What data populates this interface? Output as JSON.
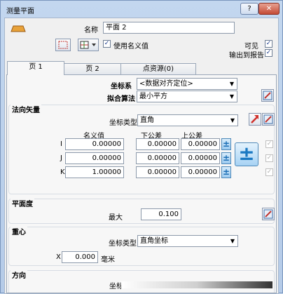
{
  "window": {
    "title": "测量平面",
    "help_label": "?",
    "close_label": "✕"
  },
  "header": {
    "name_label": "名称",
    "name_value": "平面 2",
    "use_nominal_label": "使用名义值",
    "visible_label": "可见",
    "output_report_label": "输出到报告"
  },
  "tabs": [
    {
      "label": "页 1",
      "active": true
    },
    {
      "label": "页 2",
      "active": false
    },
    {
      "label": "点资源(0)",
      "active": false
    }
  ],
  "coordinate_system": {
    "label": "坐标系",
    "value": "<数据对齐定位>"
  },
  "fit_algorithm": {
    "label": "拟合算法",
    "value": "最小平方"
  },
  "normal_vector": {
    "title": "法向矢量",
    "coord_type_label": "坐标类型",
    "coord_type_value": "直角",
    "col_nominal": "名义值",
    "col_lower": "下公差",
    "col_upper": "上公差",
    "rows": [
      {
        "axis": "I",
        "nominal": "0.00000",
        "lower": "0.00000",
        "upper": "0.00000"
      },
      {
        "axis": "J",
        "nominal": "0.00000",
        "lower": "0.00000",
        "upper": "0.00000"
      },
      {
        "axis": "K",
        "nominal": "1.00000",
        "lower": "0.00000",
        "upper": "0.00000"
      }
    ]
  },
  "flatness": {
    "title": "平面度",
    "max_label": "最大",
    "max_value": "0.100"
  },
  "centroid": {
    "title": "重心",
    "coord_type_label": "坐标类型",
    "coord_type_value": "直角坐标",
    "x_label": "X",
    "x_value": "0.000",
    "unit": "毫米"
  },
  "direction": {
    "title": "方向",
    "partial_label": "坐标"
  }
}
